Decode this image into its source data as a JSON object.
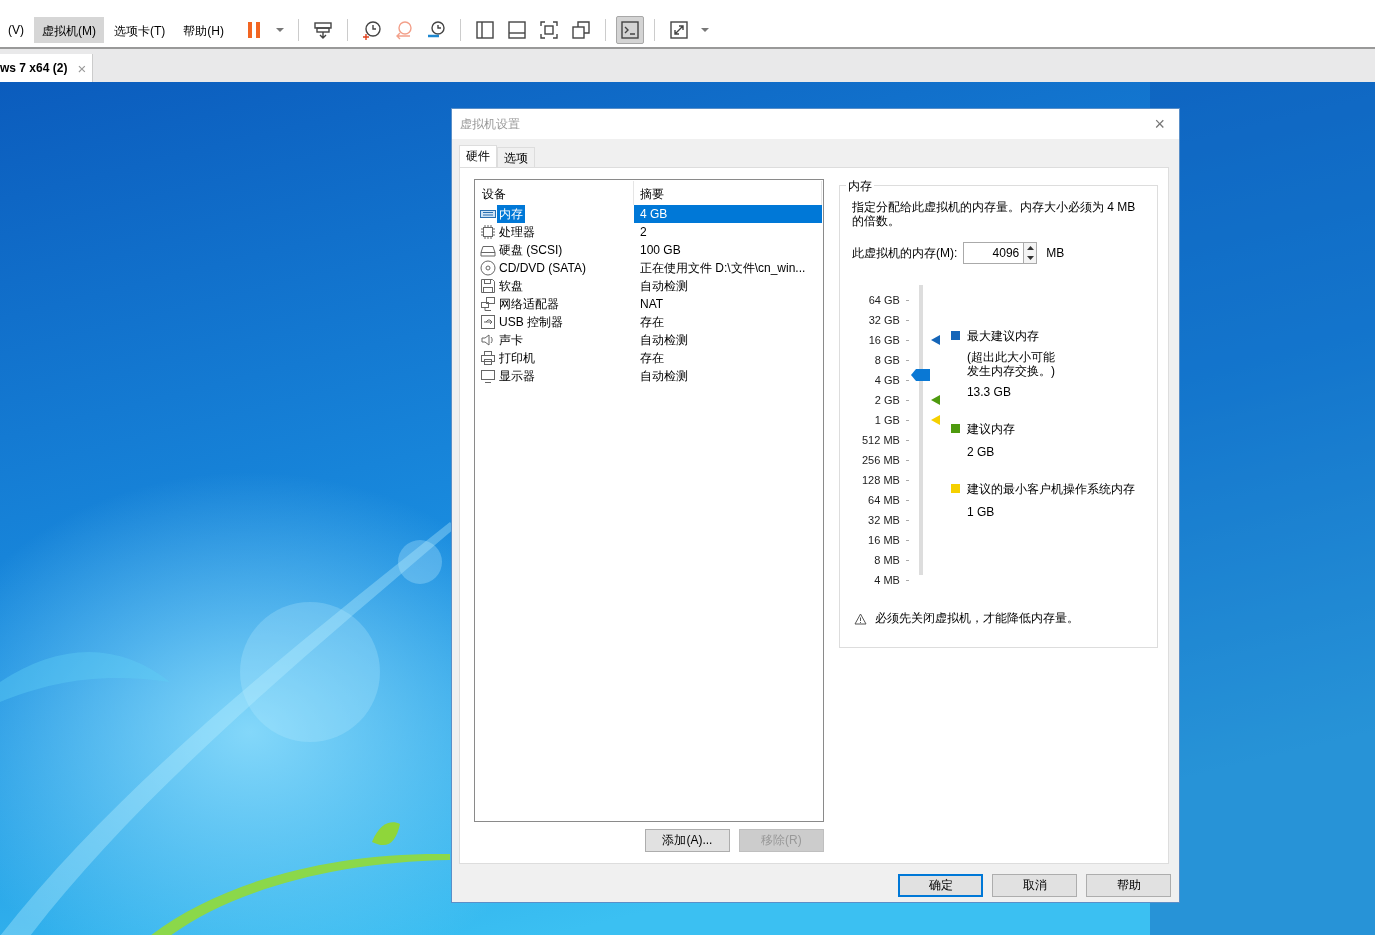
{
  "menu": [
    {
      "label": "(V)",
      "selected": false
    },
    {
      "label": "虚拟机(M)",
      "selected": true
    },
    {
      "label": "选项卡(T)",
      "selected": false
    },
    {
      "label": "帮助(H)",
      "selected": false
    }
  ],
  "toolbar": [
    {
      "items": [
        {
          "kind": "pause",
          "selected": false
        },
        {
          "kind": "caret",
          "selected": false
        }
      ]
    },
    {
      "items": [
        {
          "kind": "sendkeys",
          "selected": false
        }
      ]
    },
    {
      "items": [
        {
          "kind": "snap-take",
          "selected": false
        },
        {
          "kind": "snap-revert",
          "selected": false
        },
        {
          "kind": "snap-manage",
          "selected": false
        }
      ]
    },
    {
      "items": [
        {
          "kind": "sidebar",
          "selected": false
        },
        {
          "kind": "bottom",
          "selected": false
        },
        {
          "kind": "fullscreen",
          "selected": false
        },
        {
          "kind": "unity",
          "selected": false
        }
      ]
    },
    {
      "items": [
        {
          "kind": "console",
          "selected": true
        }
      ]
    },
    {
      "items": [
        {
          "kind": "stretch",
          "selected": false
        },
        {
          "kind": "caret",
          "selected": false
        }
      ]
    }
  ],
  "vm_tab": {
    "label": "ws 7 x64 (2)",
    "close": "×"
  },
  "dialog": {
    "title": "虚拟机设置",
    "close": "×",
    "tabs": [
      {
        "label": "硬件",
        "selected": true
      },
      {
        "label": "选项",
        "selected": false
      }
    ],
    "devices": {
      "columns": [
        "设备",
        "摘要"
      ],
      "rows": [
        {
          "kind": "memory",
          "device": "内存",
          "summary": "4 GB",
          "selected": true
        },
        {
          "kind": "cpu",
          "device": "处理器",
          "summary": "2",
          "selected": false
        },
        {
          "kind": "disk",
          "device": "硬盘 (SCSI)",
          "summary": "100 GB",
          "selected": false
        },
        {
          "kind": "cd",
          "device": "CD/DVD (SATA)",
          "summary": "正在使用文件 D:\\文件\\cn_win...",
          "selected": false
        },
        {
          "kind": "floppy",
          "device": "软盘",
          "summary": "自动检测",
          "selected": false
        },
        {
          "kind": "network",
          "device": "网络适配器",
          "summary": "NAT",
          "selected": false
        },
        {
          "kind": "usb",
          "device": "USB 控制器",
          "summary": "存在",
          "selected": false
        },
        {
          "kind": "sound",
          "device": "声卡",
          "summary": "自动检测",
          "selected": false
        },
        {
          "kind": "printer",
          "device": "打印机",
          "summary": "存在",
          "selected": false
        },
        {
          "kind": "display",
          "device": "显示器",
          "summary": "自动检测",
          "selected": false
        }
      ]
    },
    "list_buttons": [
      {
        "label": "添加(A)...",
        "disabled": false
      },
      {
        "label": "移除(R)",
        "disabled": true
      }
    ],
    "memory": {
      "group": "内存",
      "description": "指定分配给此虚拟机的内存量。内存大小必须为 4 MB 的倍数。",
      "field_label": "此虚拟机的内存(M):",
      "value": "4096",
      "unit": "MB",
      "slider": {
        "level": 0.714,
        "ticks": [
          {
            "label": "64 GB"
          },
          {
            "label": "32 GB"
          },
          {
            "label": "16 GB",
            "color": "#1565b8"
          },
          {
            "label": "8 GB"
          },
          {
            "label": "4 GB"
          },
          {
            "label": "2 GB",
            "color": "#4e9a0e"
          },
          {
            "label": "1 GB",
            "color": "#f5d000"
          },
          {
            "label": "512 MB"
          },
          {
            "label": "256 MB"
          },
          {
            "label": "128 MB"
          },
          {
            "label": "64 MB"
          },
          {
            "label": "32 MB"
          },
          {
            "label": "16 MB"
          },
          {
            "label": "8 MB"
          },
          {
            "label": "4 MB"
          }
        ]
      },
      "legend": [
        {
          "color": "#1565b8",
          "title": "最大建议内存",
          "note": "(超出此大小可能发生内存交换。)",
          "value": "13.3 GB"
        },
        {
          "color": "#4e9a0e",
          "title": "建议内存",
          "value": "2 GB"
        },
        {
          "color": "#f5d000",
          "title": "建议的最小客户机操作系统内存",
          "value": "1 GB"
        }
      ],
      "warning": "必须先关闭虚拟机，才能降低内存量。"
    },
    "buttons": [
      {
        "label": "确定",
        "default": true
      },
      {
        "label": "取消",
        "default": false
      },
      {
        "label": "帮助",
        "default": false
      }
    ]
  }
}
